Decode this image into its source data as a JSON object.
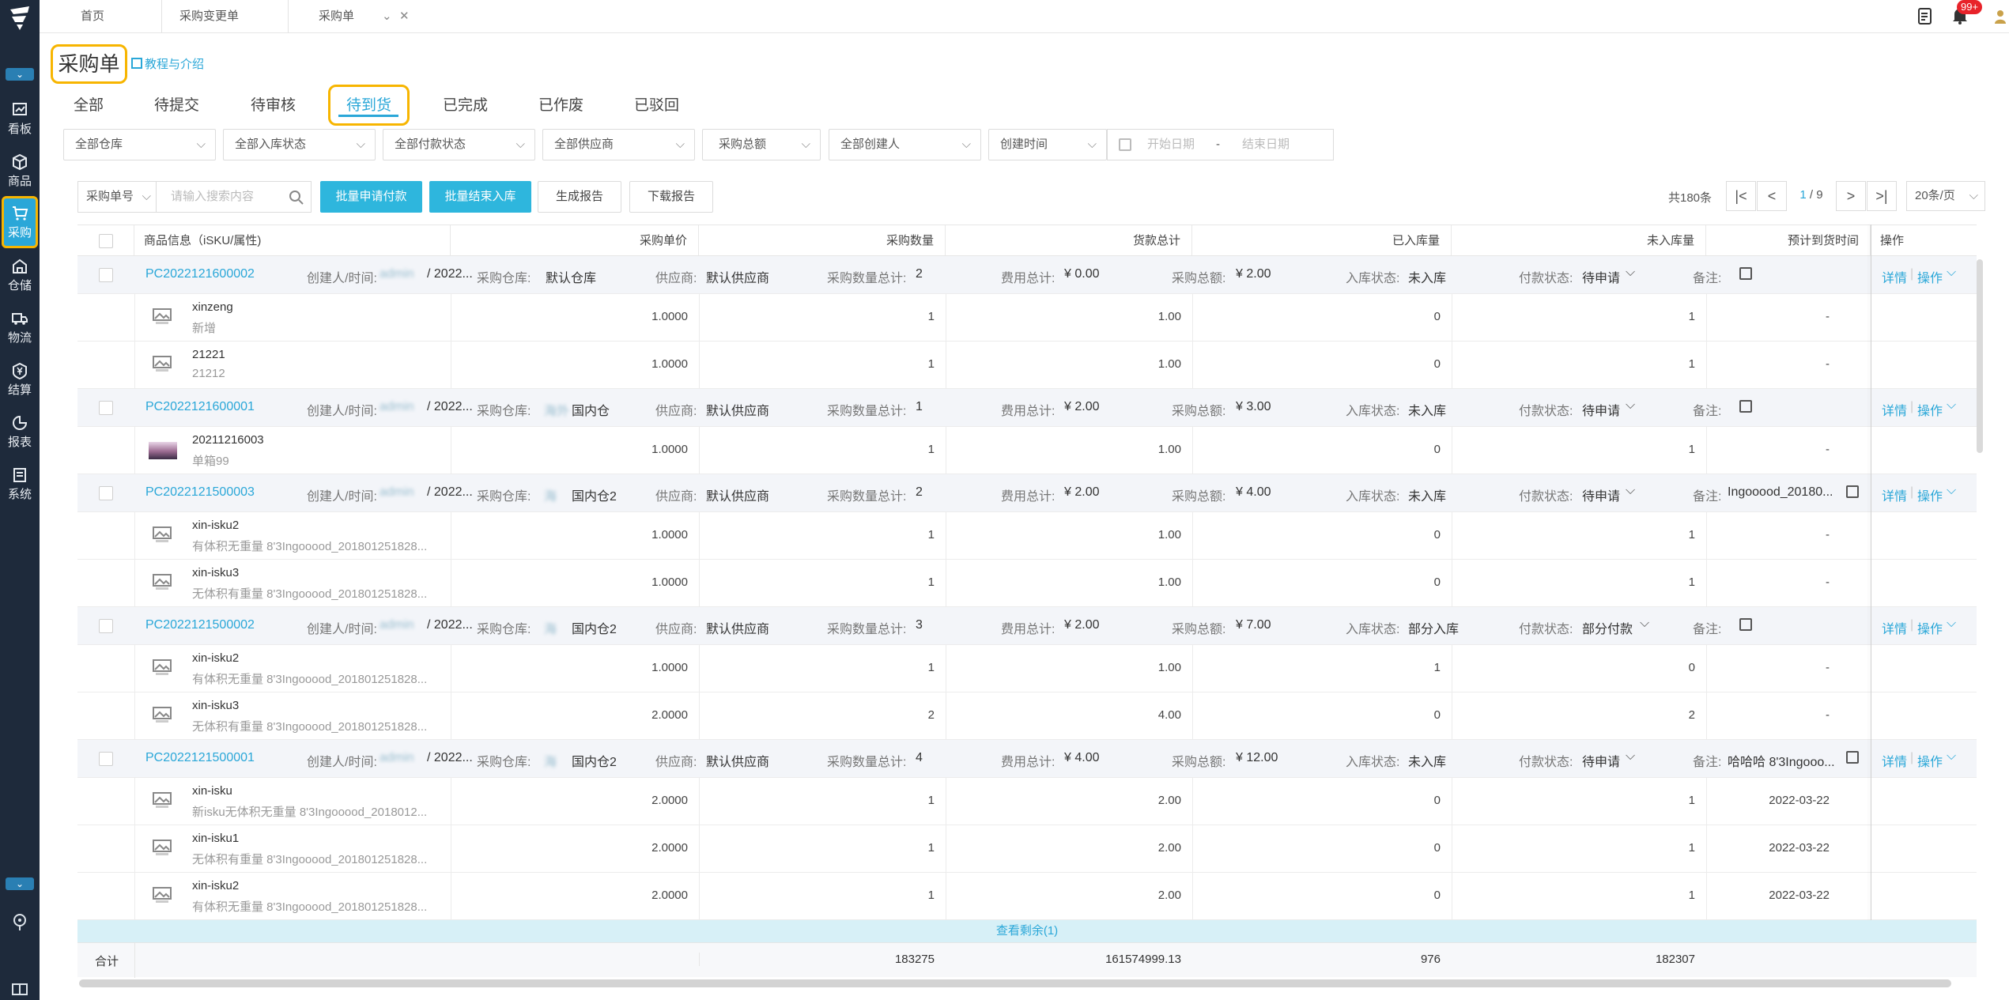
{
  "sidebar": {
    "items": [
      {
        "label": "看板",
        "icon": "dashboard-icon"
      },
      {
        "label": "商品",
        "icon": "box-icon"
      },
      {
        "label": "采购",
        "icon": "cart-icon"
      },
      {
        "label": "仓储",
        "icon": "warehouse-icon"
      },
      {
        "label": "物流",
        "icon": "truck-icon"
      },
      {
        "label": "结算",
        "icon": "yen-icon"
      },
      {
        "label": "报表",
        "icon": "chart-icon"
      },
      {
        "label": "系统",
        "icon": "system-icon"
      }
    ]
  },
  "page_tabs": [
    "首页",
    "采购变更单",
    "采购单"
  ],
  "notification_badge": "99+",
  "page_title": "采购单",
  "tutorial_link": "教程与介绍",
  "status_tabs": [
    "全部",
    "待提交",
    "待审核",
    "待到货",
    "已完成",
    "已作废",
    "已驳回"
  ],
  "filters": {
    "warehouse": "全部仓库",
    "inbound_status": "全部入库状态",
    "payment_status": "全部付款状态",
    "supplier": "全部供应商",
    "purchase_total": "采购总额",
    "creator": "全部创建人",
    "created_time": "创建时间",
    "start_date": "开始日期",
    "date_sep": "-",
    "end_date": "结束日期"
  },
  "toolbar": {
    "search_field": "采购单号",
    "search_placeholder": "请输入搜索内容",
    "batch_pay": "批量申请付款",
    "batch_finish": "批量结束入库",
    "gen_report": "生成报告",
    "download_report": "下载报告",
    "total_count": "共180条",
    "current_page": "1",
    "page_total": "/ 9",
    "page_size": "20条/页"
  },
  "columns": {
    "info": "商品信息（iSKU/属性)",
    "unit_price": "采购单价",
    "qty": "采购数量",
    "amount": "货款总计",
    "received": "已入库量",
    "pending": "未入库量",
    "eta": "预计到货时间",
    "actions": "操作"
  },
  "labels": {
    "creator_time": "创建人/时间:",
    "warehouse": "采购仓库:",
    "supplier": "供应商:",
    "qty_total": "采购数量总计:",
    "fee_total": "费用总计:",
    "purchase_total": "采购总额:",
    "inbound_status": "入库状态:",
    "payment_status": "付款状态:",
    "remark": "备注:",
    "detail": "详情",
    "operate": "操作",
    "sep": "|"
  },
  "orders": [
    {
      "po": "PC2022121600002",
      "creator": "admin",
      "time": "/ 2022...",
      "wh_blur": "",
      "warehouse": "默认仓库",
      "supplier": "默认供应商",
      "qty_total": "2",
      "fee_total": "¥ 0.00",
      "purchase_total": "¥ 2.00",
      "inbound": "未入库",
      "payment": "待申请",
      "remark": "",
      "items": [
        {
          "name": "xinzeng",
          "attr": "新增",
          "price": "1.0000",
          "qty": "1",
          "amount": "1.00",
          "received": "0",
          "pending": "1",
          "eta": "-"
        },
        {
          "name": "21221",
          "attr": "21212",
          "price": "1.0000",
          "qty": "1",
          "amount": "1.00",
          "received": "0",
          "pending": "1",
          "eta": "-"
        }
      ]
    },
    {
      "po": "PC2022121600001",
      "creator": "admin",
      "time": "/ 2022...",
      "wh_blur": "海外",
      "warehouse": "国内仓",
      "supplier": "默认供应商",
      "qty_total": "1",
      "fee_total": "¥ 2.00",
      "purchase_total": "¥ 3.00",
      "inbound": "未入库",
      "payment": "待申请",
      "remark": "",
      "items": [
        {
          "name": "20211216003",
          "attr": "单箱99",
          "price": "1.0000",
          "qty": "1",
          "amount": "1.00",
          "received": "0",
          "pending": "1",
          "eta": "-",
          "photo": true
        }
      ]
    },
    {
      "po": "PC2022121500003",
      "creator": "admin",
      "time": "/ 2022...",
      "wh_blur": "海",
      "warehouse": "国内仓2",
      "supplier": "默认供应商",
      "qty_total": "2",
      "fee_total": "¥ 2.00",
      "purchase_total": "¥ 4.00",
      "inbound": "未入库",
      "payment": "待申请",
      "remark": "Ingooood_20180...",
      "items": [
        {
          "name": "xin-isku2",
          "attr": "有体积无重量 8'3Ingooood_201801251828...",
          "price": "1.0000",
          "qty": "1",
          "amount": "1.00",
          "received": "0",
          "pending": "1",
          "eta": "-"
        },
        {
          "name": "xin-isku3",
          "attr": "无体积有重量 8'3Ingooood_201801251828...",
          "price": "1.0000",
          "qty": "1",
          "amount": "1.00",
          "received": "0",
          "pending": "1",
          "eta": "-"
        }
      ]
    },
    {
      "po": "PC2022121500002",
      "creator": "admin",
      "time": "/ 2022...",
      "wh_blur": "海",
      "warehouse": "国内仓2",
      "supplier": "默认供应商",
      "qty_total": "3",
      "fee_total": "¥ 2.00",
      "purchase_total": "¥ 7.00",
      "inbound": "部分入库",
      "payment": "部分付款",
      "remark": "",
      "items": [
        {
          "name": "xin-isku2",
          "attr": "有体积无重量 8'3Ingooood_201801251828...",
          "price": "1.0000",
          "qty": "1",
          "amount": "1.00",
          "received": "1",
          "pending": "0",
          "eta": "-"
        },
        {
          "name": "xin-isku3",
          "attr": "无体积有重量 8'3Ingooood_201801251828...",
          "price": "2.0000",
          "qty": "2",
          "amount": "4.00",
          "received": "0",
          "pending": "2",
          "eta": "-"
        }
      ]
    },
    {
      "po": "PC2022121500001",
      "creator": "admin",
      "time": "/ 2022...",
      "wh_blur": "海",
      "warehouse": "国内仓2",
      "supplier": "默认供应商",
      "qty_total": "4",
      "fee_total": "¥ 4.00",
      "purchase_total": "¥ 12.00",
      "inbound": "未入库",
      "payment": "待申请",
      "remark": "哈哈哈 8'3Ingooo...",
      "items": [
        {
          "name": "xin-isku",
          "attr": "新isku无体积无重量 8'3Ingooood_2018012...",
          "price": "2.0000",
          "qty": "1",
          "amount": "2.00",
          "received": "0",
          "pending": "1",
          "eta": "2022-03-22"
        },
        {
          "name": "xin-isku1",
          "attr": "无体积有重量 8'3Ingooood_201801251828...",
          "price": "2.0000",
          "qty": "1",
          "amount": "2.00",
          "received": "0",
          "pending": "1",
          "eta": "2022-03-22"
        },
        {
          "name": "xin-isku2",
          "attr": "有体积无重量 8'3Ingooood_201801251828...",
          "price": "2.0000",
          "qty": "1",
          "amount": "2.00",
          "received": "0",
          "pending": "1",
          "eta": "2022-03-22"
        }
      ]
    }
  ],
  "view_more": "查看剩余(1)",
  "totals": {
    "label": "合计",
    "qty": "183275",
    "amount": "161574999.13",
    "received": "976",
    "pending": "182307"
  },
  "colors": {
    "accent": "#2aa7d8",
    "highlight": "#f7b500",
    "sidebar": "#1e2a3b"
  }
}
